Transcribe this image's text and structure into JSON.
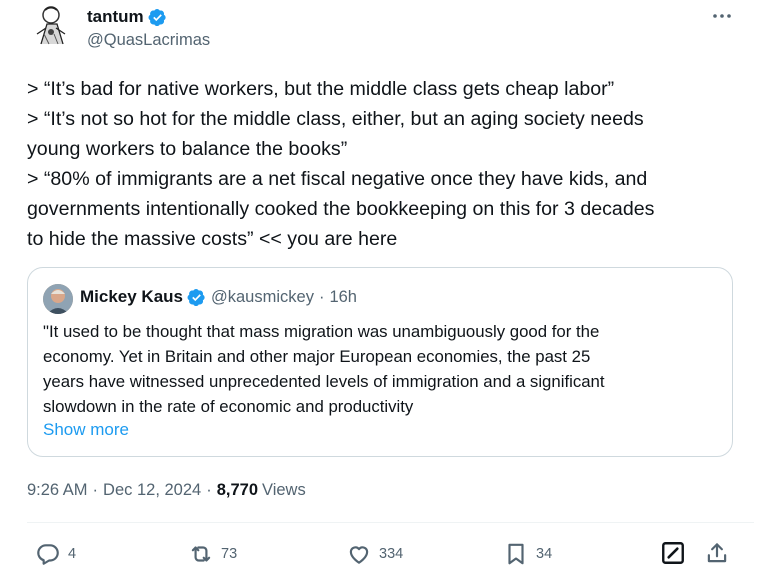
{
  "author": {
    "name": "tantum",
    "handle": "@QuasLacrimas",
    "verified": true
  },
  "tweet": {
    "lines": [
      "> “It’s bad for native workers, but the middle class gets cheap labor”",
      "> “It’s not so hot for the middle class, either, but an aging society needs",
      "young workers to balance the books”",
      "> “80% of immigrants are a net fiscal negative once they have kids, and",
      "governments intentionally cooked the bookkeeping on this for 3 decades",
      "to hide the massive costs” << you are here"
    ]
  },
  "quote": {
    "name": "Mickey Kaus",
    "handle": "@kausmickey",
    "separator": "·",
    "time": "16h",
    "lines": [
      "\"It used to be thought that mass migration was  unambiguously good for the",
      "economy. Yet in Britain and other major  European economies, the past 25",
      "years have witnessed unprecedented  levels of immigration and a significant",
      "slowdown in the rate of economic  and productivity"
    ],
    "show_more": "Show more"
  },
  "meta": {
    "time": "9:26 AM",
    "dot1": "·",
    "date": "Dec 12, 2024",
    "dot2": "·",
    "views_count": "8,770",
    "views_label": "Views"
  },
  "actions": {
    "replies": "4",
    "reposts": "73",
    "likes": "334",
    "bookmarks": "34"
  },
  "colors": {
    "accent": "#1d9bf0",
    "secondary_text": "#536471",
    "border": "#cfd9de"
  }
}
